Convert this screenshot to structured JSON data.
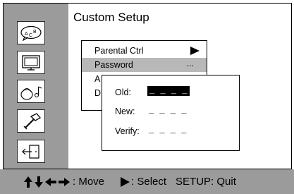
{
  "header": {
    "title": "Custom Setup"
  },
  "sidebar": {
    "icons": [
      "language-icon",
      "display-icon",
      "audio-icon",
      "setup-tools-icon",
      "exit-icon"
    ]
  },
  "menu": {
    "items": [
      {
        "label": "Parental Ctrl",
        "indicator": "right-arrow"
      },
      {
        "label": "Password",
        "indicator": "..."
      },
      {
        "label": "A"
      },
      {
        "label": "D"
      }
    ]
  },
  "dialog": {
    "old_label": "Old:",
    "old_value": "_ _ _ _",
    "new_label": "New:",
    "new_value": "_ _ _ _",
    "verify_label": "Verify:",
    "verify_value": "_ _ _ _"
  },
  "footer": {
    "move_label": ": Move",
    "select_label": ": Select",
    "quit_label": "SETUP: Quit"
  },
  "colors": {
    "panel_gray": "#9b9b9b",
    "highlight_gray": "#b8b8b8",
    "text": "#000000",
    "background": "#ffffff"
  }
}
